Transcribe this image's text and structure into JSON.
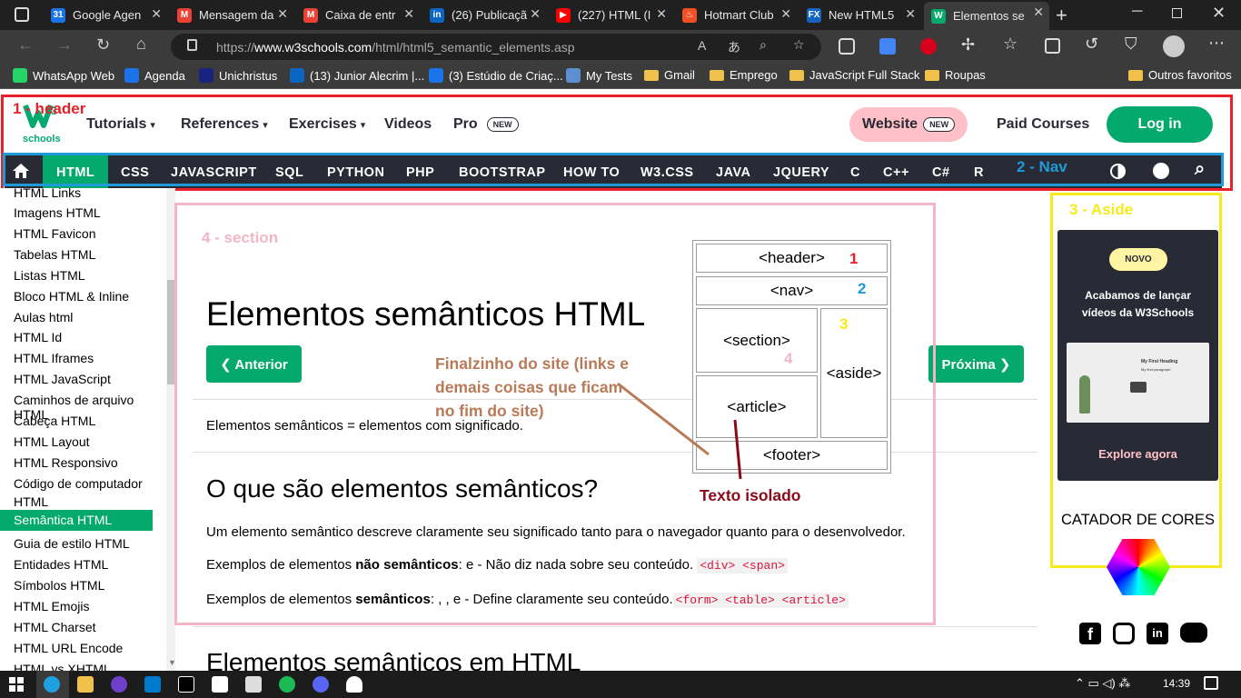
{
  "browser": {
    "tabs": [
      {
        "title": "Google Agen",
        "icon_color": "#1a73e8",
        "icon_text": "31"
      },
      {
        "title": "Mensagem da",
        "icon_color": "#ea4335",
        "icon_text": "M"
      },
      {
        "title": "Caixa de entr",
        "icon_color": "#ea4335",
        "icon_text": "M"
      },
      {
        "title": "(26) Publicaçã",
        "icon_color": "#0a66c2",
        "icon_text": "in"
      },
      {
        "title": "(227) HTML (I",
        "icon_color": "#ff0000",
        "icon_text": "▶"
      },
      {
        "title": "Hotmart Club",
        "icon_color": "#f04e23",
        "icon_text": "♨"
      },
      {
        "title": "New HTML5",
        "icon_color": "#1565c0",
        "icon_text": "FX"
      },
      {
        "title": "Elementos se",
        "icon_color": "#04aa6d",
        "icon_text": "W"
      }
    ],
    "url_prefix": "https://",
    "url_domain": "www.w3schools.com",
    "url_path": "/html/html5_semantic_elements.asp",
    "bookmarks": [
      {
        "label": "WhatsApp Web",
        "kind": "app",
        "color": "#25d366"
      },
      {
        "label": "Agenda",
        "kind": "app",
        "color": "#1a73e8"
      },
      {
        "label": "Unichristus",
        "kind": "app",
        "color": "#1a237e"
      },
      {
        "label": "(13) Junior Alecrim |...",
        "kind": "app",
        "color": "#0a66c2"
      },
      {
        "label": "(3) Estúdio de Criaç...",
        "kind": "app",
        "color": "#1a73e8"
      },
      {
        "label": "My Tests",
        "kind": "app",
        "color": "#5b8fd0"
      },
      {
        "label": "Gmail",
        "kind": "folder"
      },
      {
        "label": "Emprego",
        "kind": "folder"
      },
      {
        "label": "JavaScript Full Stack",
        "kind": "folder"
      },
      {
        "label": "Roupas",
        "kind": "folder"
      }
    ],
    "other_favorites": "Outros favoritos"
  },
  "w3": {
    "logo_sub": "schools",
    "top_nav": [
      {
        "label": "Tutorials",
        "caret": "▾"
      },
      {
        "label": "References",
        "caret": "▾"
      },
      {
        "label": "Exercises",
        "caret": "▾"
      },
      {
        "label": "Videos",
        "caret": ""
      },
      {
        "label": "Pro",
        "caret": ""
      }
    ],
    "new_badge": "NEW",
    "website_btn": "Website",
    "paid_courses": "Paid Courses",
    "login": "Log in",
    "subnav": [
      "HTML",
      "CSS",
      "JAVASCRIPT",
      "SQL",
      "PYTHON",
      "PHP",
      "BOOTSTRAP",
      "HOW TO",
      "W3.CSS",
      "JAVA",
      "JQUERY",
      "C",
      "C++",
      "C#",
      "R"
    ]
  },
  "sidebar": {
    "items": [
      "HTML Links",
      "Imagens HTML",
      "HTML Favicon",
      "Tabelas HTML",
      "Listas HTML",
      "Bloco HTML & Inline",
      "Aulas html",
      "HTML Id",
      "HTML Iframes",
      "HTML JavaScript",
      "Caminhos de arquivo HTML",
      "Cabeça HTML",
      "HTML Layout",
      "HTML Responsivo",
      "Código de computador",
      "HTML",
      "Semântica HTML",
      "Guia de estilo HTML",
      "Entidades HTML",
      "Símbolos HTML",
      "HTML Emojis",
      "HTML Charset",
      "HTML URL Encode",
      "HTML vs XHTML"
    ],
    "active_index": 16
  },
  "main": {
    "title": "Elementos semânticos HTML",
    "prev_btn": "❮ Anterior",
    "next_btn": "Próxima ❯",
    "intro": "Elementos semânticos = elementos com significado.",
    "h2": "O que são elementos semânticos?",
    "p1": "Um elemento semântico descreve claramente seu significado tanto para o navegador quanto para o desenvolvedor.",
    "p2_a": "Exemplos de elementos ",
    "p2_b": "não semânticos",
    "p2_c": ": e - Não diz nada sobre seu conteúdo.",
    "p2_code": "<div> <span>",
    "p3_a": "Exemplos de elementos ",
    "p3_b": "semânticos",
    "p3_c": ": , , e - Define claramente seu conteúdo.",
    "p3_code": "<form> <table> <article>",
    "h2b": "Elementos semânticos em HTML",
    "diagram": {
      "header": "<header>",
      "nav": "<nav>",
      "section": "<section>",
      "aside": "<aside>",
      "article": "<article>",
      "footer": "<footer>",
      "num1": "1",
      "num2": "2",
      "num3": "3",
      "num4": "4"
    }
  },
  "annotations": {
    "header": "1 - header",
    "nav": "2 - Nav",
    "aside": "3 - Aside",
    "section": "4 - section",
    "footer_note": "Finalzinho do site (links e demais coisas que ficam no fim do site)",
    "footer_line1": "Finalzinho do site (links e",
    "footer_line2": "demais coisas que ficam",
    "footer_line3": "no fim do site)",
    "isolated": "Texto isolado",
    "colors": {
      "header": "#e8212b",
      "nav": "#1f9ad6",
      "aside": "#f6ea1a",
      "section": "#f4b6c6",
      "footer": "#b97a57",
      "isolated": "#8b0a1a"
    }
  },
  "aside": {
    "badge": "NOVO",
    "ad_title_1": "Acabamos de lançar",
    "ad_title_2": "vídeos da W3Schools",
    "video_title": "My First Heading",
    "video_text": "My first paragraph.",
    "explore": "Explore agora",
    "color_picker": "CATADOR DE CORES"
  },
  "taskbar": {
    "time": "14:39"
  }
}
